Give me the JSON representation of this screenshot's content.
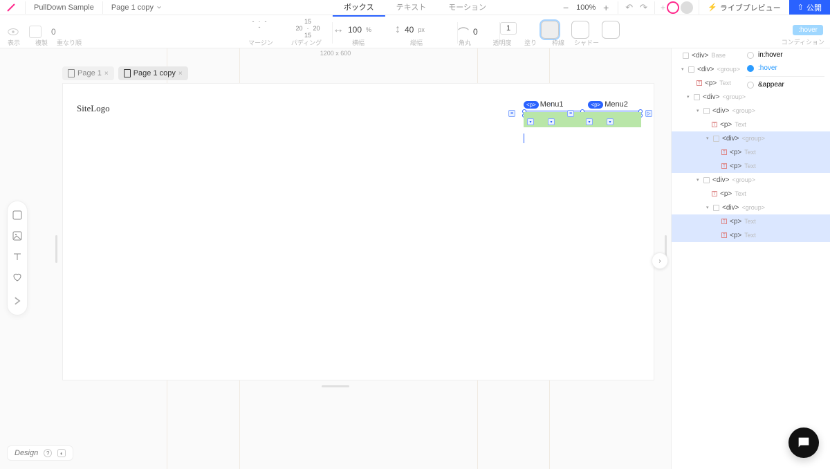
{
  "topbar": {
    "project": "PullDown Sample",
    "page": "Page 1 copy",
    "tabs": {
      "box": "ボックス",
      "text": "テキスト",
      "motion": "モーション"
    },
    "zoom": "100%",
    "live": "ライブプレビュー",
    "publish": "公開"
  },
  "propbar": {
    "field0": "0",
    "margin_lbl": "マージン",
    "padding_lbl": "パディング",
    "width_lbl": "横幅",
    "height_lbl": "縦幅",
    "radius_lbl": "角丸",
    "opacity_lbl": "透明度",
    "fill_lbl": "塗り",
    "border_lbl": "枠線",
    "shadow_lbl": "シャドー",
    "cond_lbl": "コンディション",
    "pad_top": "15",
    "pad_right": "20",
    "pad_bottom": "15",
    "pad_left": "20",
    "width_val": "100",
    "width_unit": "%",
    "height_val": "40",
    "height_unit": "px",
    "radius_val": "0",
    "opacity_val": "1",
    "hover_chip": ":hover",
    "canvas_size": "1200 x 600"
  },
  "pages": {
    "p1": "Page 1",
    "p2": "Page 1 copy"
  },
  "canvas": {
    "logo": "SiteLogo",
    "menu1": "Menu1",
    "menu2": "Menu2",
    "chip": "<p>"
  },
  "tree": {
    "div": "<div>",
    "p": "<p>",
    "base": "Base",
    "group": "<group>",
    "text": "Text"
  },
  "states": {
    "inhover": "in:hover",
    "hover": ":hover",
    "appear": "&appear"
  },
  "bottom": {
    "label": "Design"
  }
}
